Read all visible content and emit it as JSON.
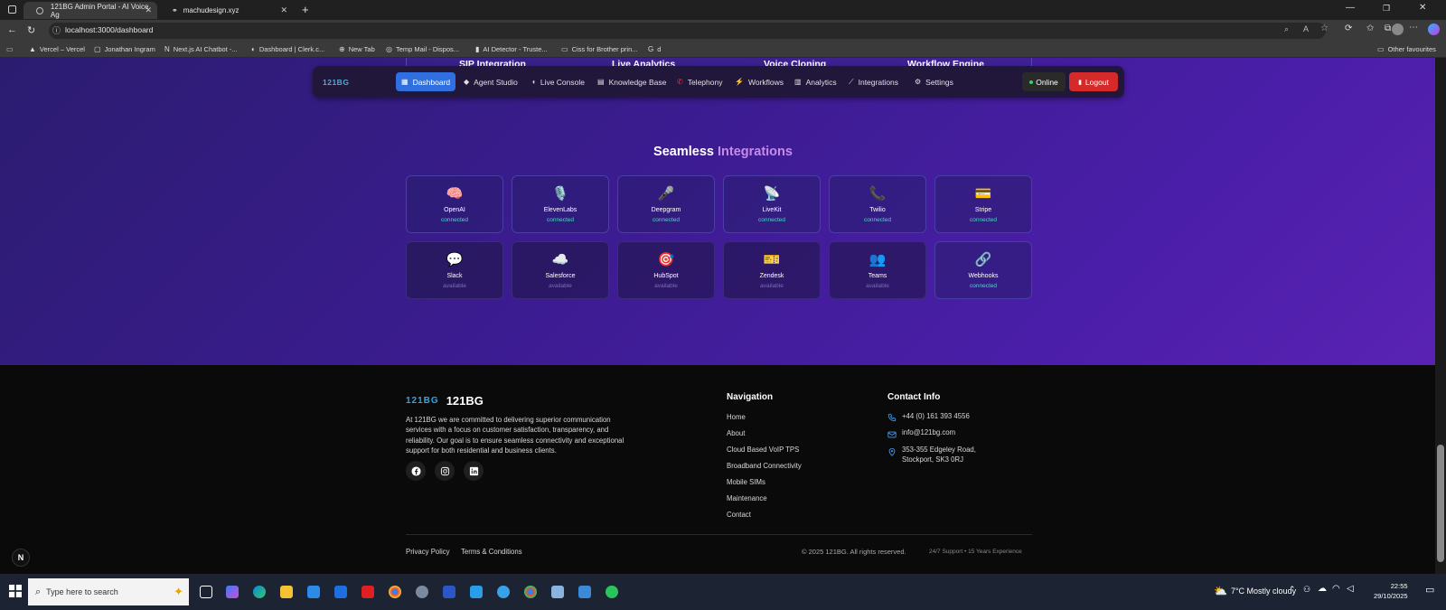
{
  "browser": {
    "tabs": [
      {
        "title": "121BG Admin Portal - AI Voice Ag",
        "active": true
      },
      {
        "title": "machudesign.xyz",
        "active": false
      }
    ],
    "new_tab": "+",
    "url": "localhost:3000/dashboard",
    "bookmarks": [
      {
        "label": "Vercel – Vercel",
        "icon": "▲"
      },
      {
        "label": "Jonathan Ingram",
        "icon": "▢"
      },
      {
        "label": "Next.js AI Chatbot -...",
        "icon": "N"
      },
      {
        "label": "Dashboard | Clerk.c...",
        "icon": "◐"
      },
      {
        "label": "New Tab",
        "icon": "⊕"
      },
      {
        "label": "Temp Mail - Dispos...",
        "icon": "◎"
      },
      {
        "label": "AI Detector - Truste...",
        "icon": "▮"
      },
      {
        "label": "Ciss for Brother prin...",
        "icon": "▭"
      },
      {
        "label": "d",
        "icon": "G"
      }
    ],
    "other_favourites": "Other favourites"
  },
  "hero": {
    "features": [
      "SIP Integration",
      "Live Analytics",
      "Voice Cloning",
      "Workflow Engine"
    ]
  },
  "nav": {
    "logo": "121BG",
    "items": [
      {
        "label": "Dashboard",
        "icon": "▦",
        "active": true
      },
      {
        "label": "Agent Studio",
        "icon": "◆"
      },
      {
        "label": "Live Console",
        "icon": "◖"
      },
      {
        "label": "Knowledge Base",
        "icon": "▤"
      },
      {
        "label": "Telephony",
        "icon": "✆"
      },
      {
        "label": "Workflows",
        "icon": "⚡"
      },
      {
        "label": "Analytics",
        "icon": "▥"
      },
      {
        "label": "Integrations",
        "icon": "⟋"
      },
      {
        "label": "Settings",
        "icon": "⚙"
      }
    ],
    "online_label": "Online",
    "logout_label": "Logout"
  },
  "integrations": {
    "title_prefix": "Seamless",
    "title_highlight": "Integrations",
    "items": [
      {
        "name": "OpenAI",
        "status": "connected",
        "icon": "🧠"
      },
      {
        "name": "ElevenLabs",
        "status": "connected",
        "icon": "🎙️"
      },
      {
        "name": "Deepgram",
        "status": "connected",
        "icon": "🎤"
      },
      {
        "name": "LiveKit",
        "status": "connected",
        "icon": "📡"
      },
      {
        "name": "Twilio",
        "status": "connected",
        "icon": "📞"
      },
      {
        "name": "Stripe",
        "status": "connected",
        "icon": "💳"
      },
      {
        "name": "Slack",
        "status": "available",
        "icon": "💬"
      },
      {
        "name": "Salesforce",
        "status": "available",
        "icon": "☁️"
      },
      {
        "name": "HubSpot",
        "status": "available",
        "icon": "🎯"
      },
      {
        "name": "Zendesk",
        "status": "available",
        "icon": "🎫"
      },
      {
        "name": "Teams",
        "status": "available",
        "icon": "👥"
      },
      {
        "name": "Webhooks",
        "status": "connected",
        "icon": "🔗"
      }
    ]
  },
  "footer": {
    "logo_mark": "121BG",
    "brand": "121BG",
    "description": "At 121BG we are committed to delivering superior communication services with a focus on customer satisfaction, transparency, and reliability. Our goal is to ensure seamless connectivity and exceptional support for both residential and business clients.",
    "social": [
      "facebook-icon",
      "instagram-icon",
      "linkedin-icon"
    ],
    "navigation_title": "Navigation",
    "navigation": [
      "Home",
      "About",
      "Cloud Based VoIP TPS",
      "Broadband Connectivity",
      "Mobile SIMs",
      "Maintenance",
      "Contact"
    ],
    "contact_title": "Contact Info",
    "phone": "+44 (0) 161 393 4556",
    "email": "info@121bg.com",
    "address_line1": "353-355 Edgeley Road,",
    "address_line2": "Stockport, SK3 0RJ",
    "privacy": "Privacy Policy",
    "terms": "Terms & Conditions",
    "copyright": "© 2025 121BG. All rights reserved.",
    "support": "24/7 Support • 15 Years Experience",
    "badge": "N"
  },
  "taskbar": {
    "search_placeholder": "Type here to search",
    "weather": "7°C  Mostly cloudy",
    "time": "22:55",
    "date": "29/10/2025"
  },
  "colors": {
    "accent": "#2f6fe0",
    "logout": "#d42a2a",
    "connected": "#4fd6c9",
    "highlight": "#c78be8"
  }
}
